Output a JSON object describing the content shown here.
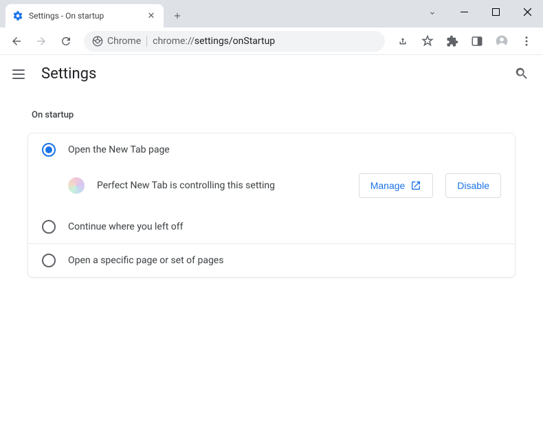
{
  "window": {
    "tab_title": "Settings - On startup"
  },
  "omnibox": {
    "secure_label": "Chrome",
    "url_host": "chrome://",
    "url_path": "settings/onStartup"
  },
  "app": {
    "title": "Settings"
  },
  "section": {
    "heading": "On startup",
    "options": [
      {
        "label": "Open the New Tab page",
        "selected": true
      },
      {
        "label": "Continue where you left off",
        "selected": false
      },
      {
        "label": "Open a specific page or set of pages",
        "selected": false
      }
    ],
    "extension_notice": {
      "message": "Perfect New Tab is controlling this setting",
      "manage_label": "Manage",
      "disable_label": "Disable"
    }
  }
}
